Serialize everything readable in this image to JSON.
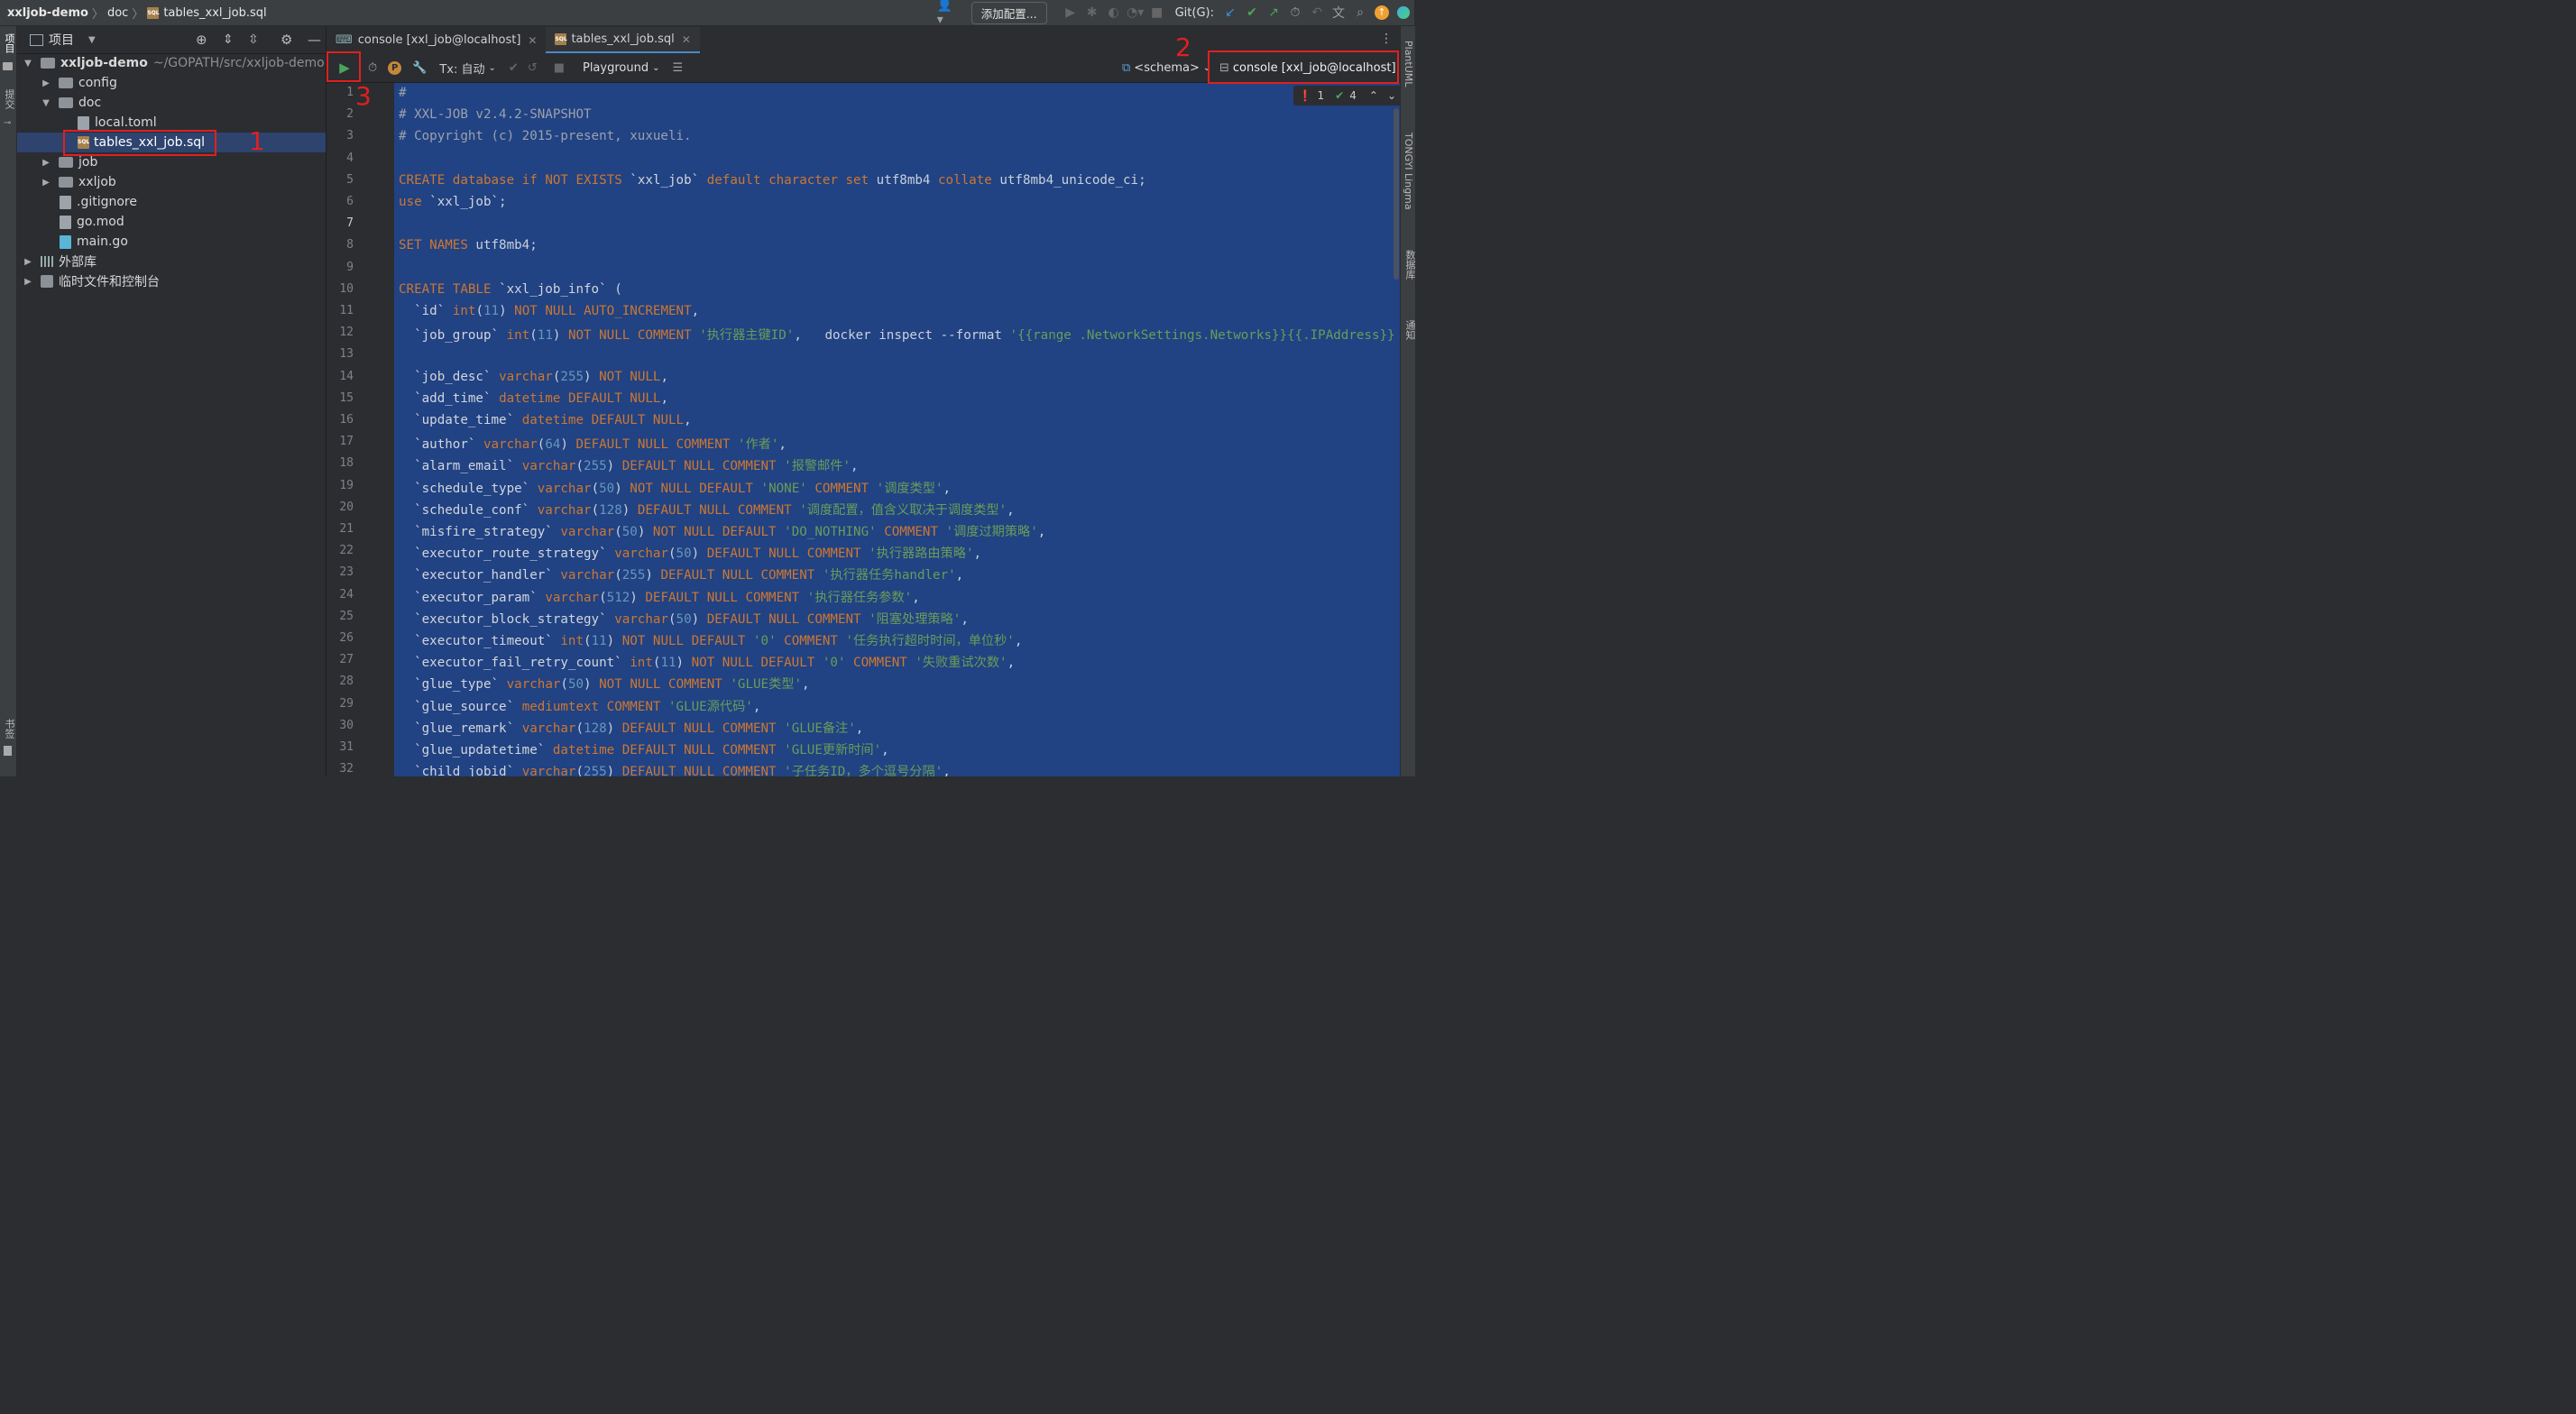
{
  "breadcrumb": {
    "project": "xxljob-demo",
    "folder": "doc",
    "file": "tables_xxl_job.sql"
  },
  "toolbar": {
    "add_config_label": "添加配置...",
    "git_label": "Git(G):"
  },
  "left_strip": {
    "project_label": "项目",
    "commit_label": "提交",
    "bookmarks_label": "书签"
  },
  "right_strip": {
    "plantuml_label": "PlantUML",
    "tongyi_label": "TONGYI Lingma",
    "database_label": "数据库",
    "notifications_label": "通知"
  },
  "project_panel": {
    "title": "项目",
    "tree": [
      {
        "label": "xxljob-demo",
        "hint": "~/GOPATH/src/xxljob-demo",
        "type": "root",
        "expanded": true
      },
      {
        "label": "config",
        "type": "folder",
        "expanded": false
      },
      {
        "label": "doc",
        "type": "folder",
        "expanded": true
      },
      {
        "label": "local.toml",
        "type": "file"
      },
      {
        "label": "tables_xxl_job.sql",
        "type": "sql",
        "selected": true
      },
      {
        "label": "job",
        "type": "folder",
        "expanded": false
      },
      {
        "label": "xxljob",
        "type": "folder",
        "expanded": false
      },
      {
        "label": ".gitignore",
        "type": "file"
      },
      {
        "label": "go.mod",
        "type": "file"
      },
      {
        "label": "main.go",
        "type": "file"
      },
      {
        "label": "外部库",
        "type": "library"
      },
      {
        "label": "临时文件和控制台",
        "type": "scratch"
      }
    ]
  },
  "editor_tabs": [
    {
      "label": "console [xxl_job@localhost]",
      "active": false
    },
    {
      "label": "tables_xxl_job.sql",
      "active": true
    }
  ],
  "editor_toolbar": {
    "tx_label": "Tx: 自动",
    "playground_label": "Playground",
    "schema_label": "<schema>",
    "console_label": "console [xxl_job@localhost]"
  },
  "inspections": {
    "errors": "1",
    "ok": "4"
  },
  "annotations": [
    "1",
    "2",
    "3"
  ],
  "code_lines": [
    "#",
    "# XXL-JOB v2.4.2-SNAPSHOT",
    "# Copyright (c) 2015-present, xuxueli.",
    "",
    "CREATE database if NOT EXISTS `xxl_job` default character set utf8mb4 collate utf8mb4_unicode_ci;",
    "use `xxl_job`;",
    "",
    "SET NAMES utf8mb4;",
    "",
    "CREATE TABLE `xxl_job_info` (",
    "  `id` int(11) NOT NULL AUTO_INCREMENT,",
    "  `job_group` int(11) NOT NULL COMMENT '执行器主键ID',   docker inspect --format '{{range .NetworkSettings.Networks}}{{.IPAddress}}",
    "",
    "  `job_desc` varchar(255) NOT NULL,",
    "  `add_time` datetime DEFAULT NULL,",
    "  `update_time` datetime DEFAULT NULL,",
    "  `author` varchar(64) DEFAULT NULL COMMENT '作者',",
    "  `alarm_email` varchar(255) DEFAULT NULL COMMENT '报警邮件',",
    "  `schedule_type` varchar(50) NOT NULL DEFAULT 'NONE' COMMENT '调度类型',",
    "  `schedule_conf` varchar(128) DEFAULT NULL COMMENT '调度配置，值含义取决于调度类型',",
    "  `misfire_strategy` varchar(50) NOT NULL DEFAULT 'DO_NOTHING' COMMENT '调度过期策略',",
    "  `executor_route_strategy` varchar(50) DEFAULT NULL COMMENT '执行器路由策略',",
    "  `executor_handler` varchar(255) DEFAULT NULL COMMENT '执行器任务handler',",
    "  `executor_param` varchar(512) DEFAULT NULL COMMENT '执行器任务参数',",
    "  `executor_block_strategy` varchar(50) DEFAULT NULL COMMENT '阻塞处理策略',",
    "  `executor_timeout` int(11) NOT NULL DEFAULT '0' COMMENT '任务执行超时时间，单位秒',",
    "  `executor_fail_retry_count` int(11) NOT NULL DEFAULT '0' COMMENT '失败重试次数',",
    "  `glue_type` varchar(50) NOT NULL COMMENT 'GLUE类型',",
    "  `glue_source` mediumtext COMMENT 'GLUE源代码',",
    "  `glue_remark` varchar(128) DEFAULT NULL COMMENT 'GLUE备注',",
    "  `glue_updatetime` datetime DEFAULT NULL COMMENT 'GLUE更新时间',",
    "  `child_jobid` varchar(255) DEFAULT NULL COMMENT '子任务ID，多个逗号分隔',"
  ],
  "colors": {
    "selection": "#214283",
    "keyword": "#cc7832",
    "string": "#6a9c59",
    "number": "#6897bb",
    "annotation_red": "#e02020"
  }
}
